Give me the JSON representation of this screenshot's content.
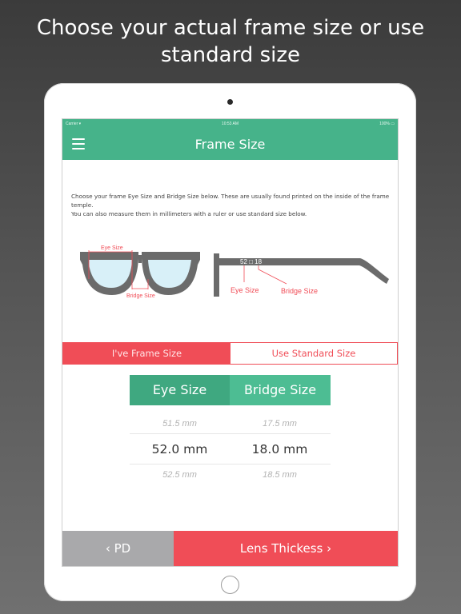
{
  "headline": {
    "line1": "Choose your actual frame size or use",
    "line2": "standard size"
  },
  "statusbar": {
    "carrier": "Carrier ▾",
    "time": "10:53 AM",
    "battery": "100% ▭"
  },
  "navbar": {
    "menu_icon": "hamburger-menu-icon",
    "title": "Frame Size"
  },
  "instructions": {
    "line1": "Choose your frame Eye Size and Bridge Size below. These are usually found printed on the inside of the frame temple.",
    "line2": "You can also measure them in millimeters with a ruler or use standard size below."
  },
  "diagram": {
    "front_eye_label": "Eye Size",
    "front_bridge_label": "Bridge Size",
    "temple_marking": "52 □ 18",
    "side_eye_label": "Eye Size",
    "side_bridge_label": "Bridge Size"
  },
  "tabs": {
    "frame_size": "I've Frame Size",
    "standard_size": "Use Standard Size"
  },
  "picker": {
    "eye_header": "Eye Size",
    "bridge_header": "Bridge Size",
    "eye_prev": "51.5 mm",
    "bridge_prev": "17.5 mm",
    "eye_selected": "52.0 mm",
    "bridge_selected": "18.0 mm",
    "eye_next": "52.5 mm",
    "bridge_next": "18.5 mm"
  },
  "footer": {
    "back_label": "‹ PD",
    "next_label": "Lens Thickess ›"
  },
  "colors": {
    "brand_green": "#46b38a",
    "accent_red": "#f04d57",
    "frame_gray": "#6b6b6b",
    "lens_blue": "#d8f0f8"
  }
}
